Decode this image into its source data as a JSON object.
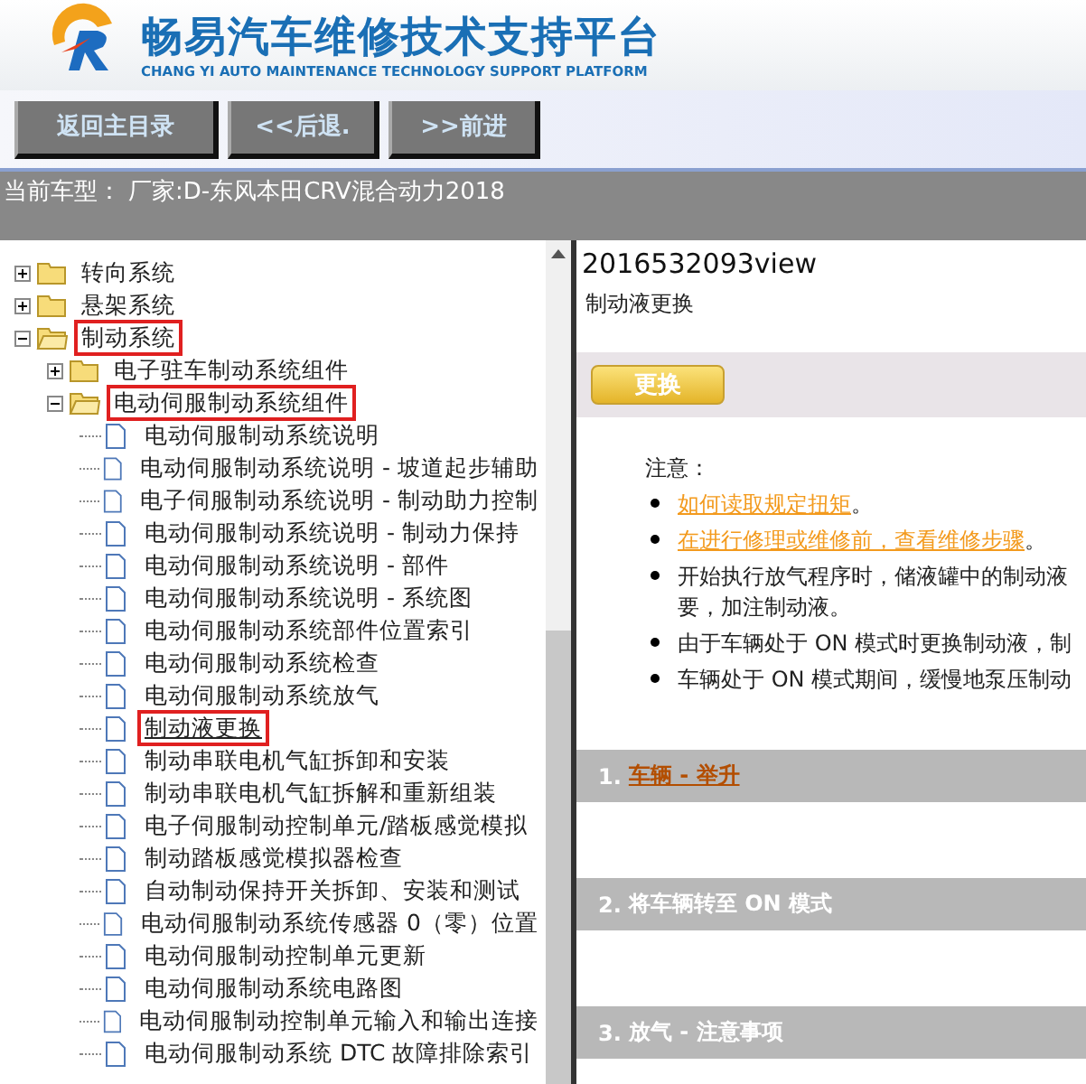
{
  "header": {
    "title": "畅易汽车维修技术支持平台",
    "subtitle": "CHANG YI AUTO MAINTENANCE TECHNOLOGY SUPPORT PLATFORM"
  },
  "nav_buttons": [
    "返回主目录",
    "<<后退.",
    ">>前进"
  ],
  "vehicle_bar": {
    "label": "当前车型：",
    "value": "厂家:D-东风本田CRV混合动力2018"
  },
  "tree": [
    {
      "label": "转向系统",
      "kind": "folder",
      "expanded": false,
      "highlighted": false,
      "selected": false
    },
    {
      "label": "悬架系统",
      "kind": "folder",
      "expanded": false,
      "highlighted": false,
      "selected": false
    },
    {
      "label": "制动系统",
      "kind": "folder",
      "expanded": true,
      "highlighted": true,
      "selected": false,
      "children": [
        {
          "label": "电子驻车制动系统组件",
          "kind": "folder",
          "expanded": false,
          "highlighted": false,
          "selected": false
        },
        {
          "label": "电动伺服制动系统组件",
          "kind": "folder",
          "expanded": true,
          "highlighted": true,
          "selected": false,
          "children": [
            {
              "label": "电动伺服制动系统说明",
              "kind": "doc",
              "highlighted": false,
              "selected": false
            },
            {
              "label": "电动伺服制动系统说明 - 坡道起步辅助",
              "kind": "doc",
              "highlighted": false,
              "selected": false
            },
            {
              "label": "电子伺服制动系统说明 - 制动助力控制",
              "kind": "doc",
              "highlighted": false,
              "selected": false
            },
            {
              "label": "电动伺服制动系统说明 - 制动力保持",
              "kind": "doc",
              "highlighted": false,
              "selected": false
            },
            {
              "label": "电动伺服制动系统说明 - 部件",
              "kind": "doc",
              "highlighted": false,
              "selected": false
            },
            {
              "label": "电动伺服制动系统说明 - 系统图",
              "kind": "doc",
              "highlighted": false,
              "selected": false
            },
            {
              "label": "电动伺服制动系统部件位置索引",
              "kind": "doc",
              "highlighted": false,
              "selected": false
            },
            {
              "label": "电动伺服制动系统检查",
              "kind": "doc",
              "highlighted": false,
              "selected": false
            },
            {
              "label": "电动伺服制动系统放气",
              "kind": "doc",
              "highlighted": false,
              "selected": false
            },
            {
              "label": "制动液更换",
              "kind": "doc",
              "highlighted": true,
              "selected": true
            },
            {
              "label": "制动串联电机气缸拆卸和安装",
              "kind": "doc",
              "highlighted": false,
              "selected": false
            },
            {
              "label": "制动串联电机气缸拆解和重新组装",
              "kind": "doc",
              "highlighted": false,
              "selected": false
            },
            {
              "label": "电子伺服制动控制单元/踏板感觉模拟",
              "kind": "doc",
              "highlighted": false,
              "selected": false
            },
            {
              "label": "制动踏板感觉模拟器检查",
              "kind": "doc",
              "highlighted": false,
              "selected": false
            },
            {
              "label": "自动制动保持开关拆卸、安装和测试",
              "kind": "doc",
              "highlighted": false,
              "selected": false
            },
            {
              "label": "电动伺服制动系统传感器 0（零）位置",
              "kind": "doc",
              "highlighted": false,
              "selected": false
            },
            {
              "label": "电动伺服制动控制单元更新",
              "kind": "doc",
              "highlighted": false,
              "selected": false
            },
            {
              "label": "电动伺服制动系统电路图",
              "kind": "doc",
              "highlighted": false,
              "selected": false
            },
            {
              "label": "电动伺服制动控制单元输入和输出连接",
              "kind": "doc",
              "highlighted": false,
              "selected": false
            },
            {
              "label": "电动伺服制动系统 DTC 故障排除索引",
              "kind": "doc",
              "highlighted": false,
              "selected": false
            }
          ]
        }
      ]
    }
  ],
  "content": {
    "doc_id": "2016532093view",
    "title": "制动液更换",
    "section_button": "更换",
    "note_label": "注意：",
    "notes": [
      {
        "kind": "link",
        "lines": [
          "如何读取规定扭矩"
        ],
        "suffix": "。"
      },
      {
        "kind": "link",
        "lines": [
          "在进行修理或维修前，查看维修步骤"
        ],
        "suffix": "。"
      },
      {
        "kind": "text",
        "lines": [
          "开始执行放气程序时，储液罐中的制动液",
          "要，加注制动液。"
        ]
      },
      {
        "kind": "text",
        "lines": [
          "由于车辆处于 ON 模式时更换制动液，制"
        ]
      },
      {
        "kind": "text",
        "lines": [
          "车辆处于 ON 模式期间，缓慢地泵压制动"
        ]
      }
    ],
    "steps": [
      {
        "number": "1.",
        "text": "车辆 - 举升",
        "kind": "link"
      },
      {
        "number": "2.",
        "text": "将车辆转至 ON 模式",
        "kind": "text"
      },
      {
        "number": "3.",
        "text": "放气 - 注意事项",
        "kind": "text"
      }
    ]
  }
}
